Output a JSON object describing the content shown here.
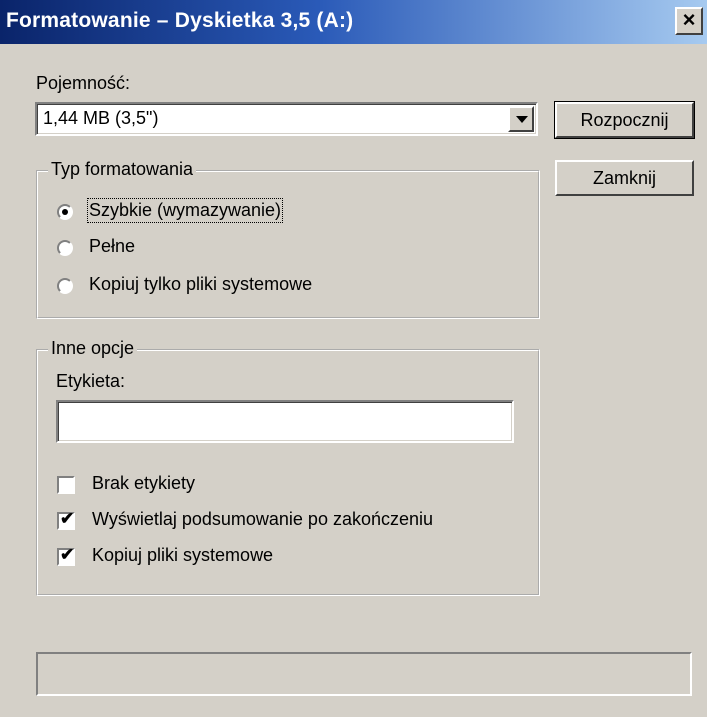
{
  "window": {
    "title": "Formatowanie – Dyskietka 3,5 (A:)",
    "close_icon": "×"
  },
  "capacity": {
    "label": "Pojemność:",
    "value": "1,44 MB (3,5\")"
  },
  "buttons": {
    "start": "Rozpocznij",
    "close": "Zamknij"
  },
  "format_type": {
    "title": "Typ formatowania",
    "options": [
      {
        "label": "Szybkie (wymazywanie)",
        "selected": true
      },
      {
        "label": "Pełne",
        "selected": false
      },
      {
        "label": "Kopiuj tylko pliki systemowe",
        "selected": false
      }
    ]
  },
  "other_options": {
    "title": "Inne opcje",
    "label_field": {
      "label": "Etykieta:",
      "value": ""
    },
    "checkboxes": [
      {
        "label": "Brak etykiety",
        "checked": false
      },
      {
        "label": "Wyświetlaj podsumowanie po zakończeniu",
        "checked": true
      },
      {
        "label": "Kopiuj pliki systemowe",
        "checked": true
      }
    ]
  },
  "status": {
    "text": ""
  },
  "colors": {
    "titlebar_start": "#0a246a",
    "titlebar_end": "#a6caf0",
    "face": "#d4d0c8"
  }
}
